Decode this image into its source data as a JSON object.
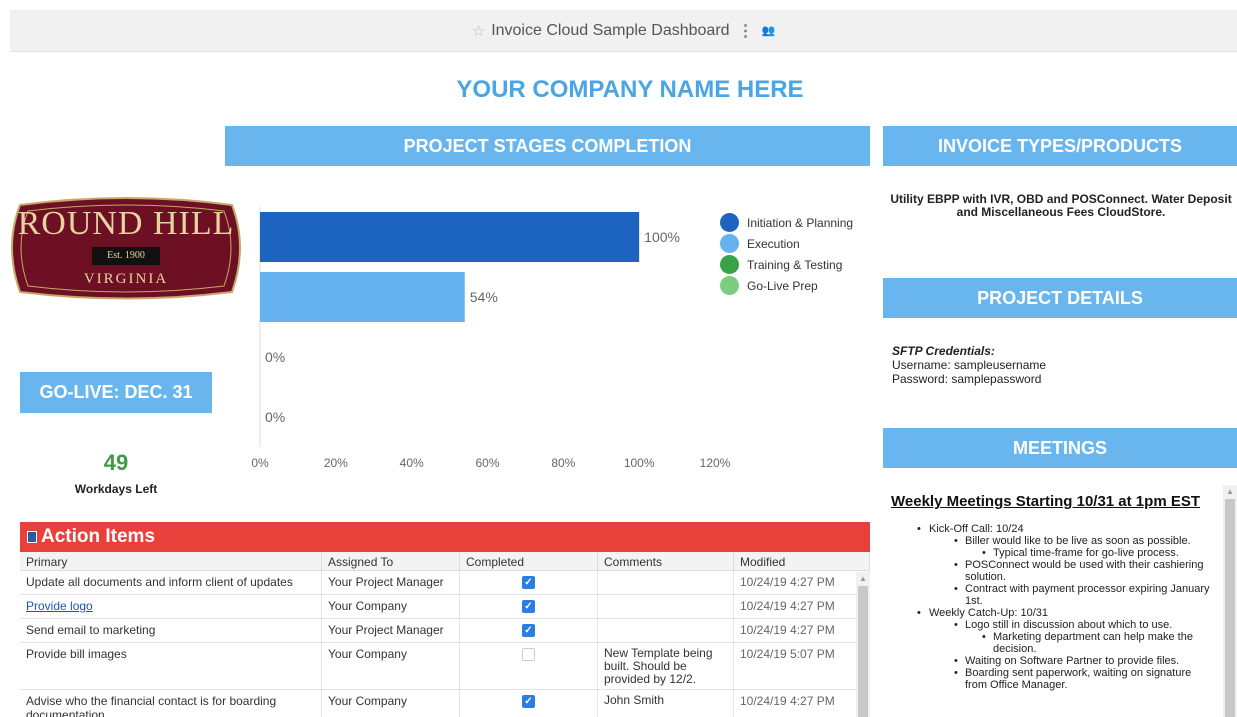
{
  "topbar": {
    "title": "Invoice Cloud Sample Dashboard",
    "star_icon": "star-icon",
    "more_icon": "more-vertical-icon",
    "share_icon": "share-users-icon"
  },
  "company_name": "YOUR COMPANY NAME HERE",
  "logo": {
    "text_top": "ROUND HILL",
    "text_mid": "Est. 1900",
    "text_bottom": "VIRGINIA"
  },
  "stages": {
    "header": "PROJECT STAGES COMPLETION"
  },
  "golive": {
    "label": "GO-LIVE: DEC. 31",
    "days": "49",
    "days_label": "Workdays Left"
  },
  "chart_data": {
    "type": "bar",
    "orientation": "horizontal",
    "categories": [
      "Initiation & Planning",
      "Execution",
      "Training & Testing",
      "Go-Live Prep"
    ],
    "values": [
      100,
      54,
      0,
      0
    ],
    "value_labels": [
      "100%",
      "54%",
      "0%",
      "0%"
    ],
    "colors": [
      "#1d64c0",
      "#66b2f0",
      "#3aa246",
      "#7ccd7f"
    ],
    "xlim": [
      0,
      120
    ],
    "xticks": [
      "0%",
      "20%",
      "40%",
      "60%",
      "80%",
      "100%",
      "120%"
    ],
    "legend_position": "right",
    "grid": false
  },
  "types": {
    "header": "INVOICE TYPES/PRODUCTS",
    "text": "Utility EBPP with IVR, OBD and POSConnect. Water Deposit and Miscellaneous Fees CloudStore."
  },
  "details": {
    "header": "PROJECT DETAILS",
    "label": "SFTP Credentials:",
    "username": "Username: sampleusername",
    "password": "Password: samplepassword"
  },
  "meetings": {
    "header": "MEETINGS",
    "title": "Weekly Meetings Starting 10/31 at 1pm EST",
    "sections": [
      {
        "title": "Kick-Off Call: 10/24",
        "items": [
          {
            "text": "Biller would like to be live as soon as possible.",
            "sub": [
              "Typical time-frame for go-live process."
            ]
          },
          {
            "text": "POSConnect would be used with their cashiering solution.",
            "sub": []
          },
          {
            "text": "Contract with payment processor expiring January 1st.",
            "sub": []
          }
        ]
      },
      {
        "title": "Weekly Catch-Up: 10/31",
        "items": [
          {
            "text": "Logo still in discussion about which to use.",
            "sub": [
              "Marketing department can help make the decision."
            ]
          },
          {
            "text": "Waiting on Software Partner to provide files.",
            "sub": []
          },
          {
            "text": "Boarding sent paperwork, waiting on signature from Office Manager.",
            "sub": []
          }
        ]
      }
    ]
  },
  "action_items": {
    "header": "Action Items",
    "columns": [
      "Primary",
      "Assigned To",
      "Completed",
      "Comments",
      "Modified"
    ],
    "rows": [
      {
        "primary": "Update all documents and inform client of updates",
        "assigned": "Your Project Manager",
        "completed": true,
        "comments": "",
        "modified": "10/24/19 4:27 PM"
      },
      {
        "primary": "Provide logo",
        "assigned": "Your Company",
        "completed": true,
        "comments": "",
        "modified": "10/24/19 4:27 PM"
      },
      {
        "primary": "Send email to marketing",
        "assigned": "Your Project Manager",
        "completed": true,
        "comments": "",
        "modified": "10/24/19 4:27 PM"
      },
      {
        "primary": "Provide bill images",
        "assigned": "Your Company",
        "completed": false,
        "comments": "New Template being built. Should be provided by 12/2.",
        "modified": "10/24/19 5:07 PM"
      },
      {
        "primary": "Advise who the financial contact is for boarding documentation",
        "assigned": "Your Company",
        "completed": true,
        "comments": "John Smith",
        "modified": "10/24/19 4:27 PM"
      }
    ]
  }
}
